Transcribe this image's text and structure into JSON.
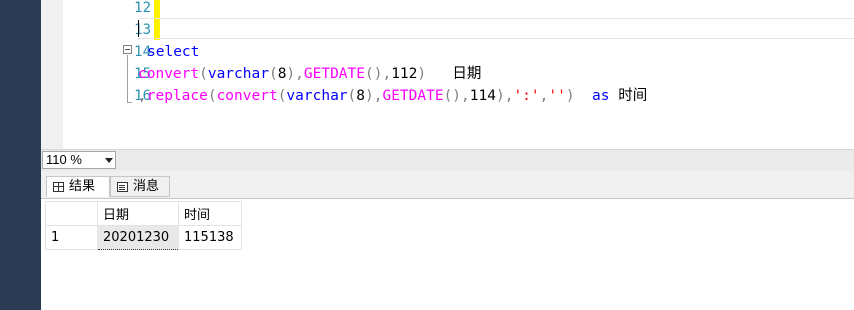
{
  "editor": {
    "line_numbers": [
      "12",
      "13",
      "14",
      "15",
      "16"
    ],
    "lines": [
      [],
      [],
      [
        {
          "t": "select",
          "c": "kw"
        }
      ],
      [
        {
          "t": "convert",
          "c": "fn"
        },
        {
          "t": "(",
          "c": "gray"
        },
        {
          "t": "varchar",
          "c": "kw"
        },
        {
          "t": "(",
          "c": "gray"
        },
        {
          "t": "8",
          "c": "plain"
        },
        {
          "t": ")",
          "c": "gray"
        },
        {
          "t": ",",
          "c": "gray"
        },
        {
          "t": "GETDATE",
          "c": "fn"
        },
        {
          "t": "()",
          "c": "gray"
        },
        {
          "t": ",",
          "c": "gray"
        },
        {
          "t": "112",
          "c": "plain"
        },
        {
          "t": ")",
          "c": "gray"
        },
        {
          "t": "   日期",
          "c": "plain"
        }
      ],
      [
        {
          "t": ",",
          "c": "gray"
        },
        {
          "t": "replace",
          "c": "fn"
        },
        {
          "t": "(",
          "c": "gray"
        },
        {
          "t": "convert",
          "c": "fn"
        },
        {
          "t": "(",
          "c": "gray"
        },
        {
          "t": "varchar",
          "c": "kw"
        },
        {
          "t": "(",
          "c": "gray"
        },
        {
          "t": "8",
          "c": "plain"
        },
        {
          "t": ")",
          "c": "gray"
        },
        {
          "t": ",",
          "c": "gray"
        },
        {
          "t": "GETDATE",
          "c": "fn"
        },
        {
          "t": "()",
          "c": "gray"
        },
        {
          "t": ",",
          "c": "gray"
        },
        {
          "t": "114",
          "c": "plain"
        },
        {
          "t": ")",
          "c": "gray"
        },
        {
          "t": ",",
          "c": "gray"
        },
        {
          "t": "':'",
          "c": "str"
        },
        {
          "t": ",",
          "c": "gray"
        },
        {
          "t": "''",
          "c": "str"
        },
        {
          "t": ")",
          "c": "gray"
        },
        {
          "t": "  as ",
          "c": "kw"
        },
        {
          "t": "时间",
          "c": "plain"
        }
      ]
    ]
  },
  "zoom": {
    "value": "110 %"
  },
  "tabs": [
    {
      "label": "结果",
      "icon": "grid-icon"
    },
    {
      "label": "消息",
      "icon": "messages-icon"
    }
  ],
  "results": {
    "columns": [
      "日期",
      "时间"
    ],
    "rows": [
      {
        "row_number": "1",
        "cells": [
          "20201230",
          "115138"
        ]
      }
    ]
  },
  "colors": {
    "keyword": "#0000ff",
    "function": "#ff00ff",
    "operator": "#808080",
    "string": "#ff0000",
    "line_number": "#2b91af",
    "left_strip": "#2b3a55"
  }
}
